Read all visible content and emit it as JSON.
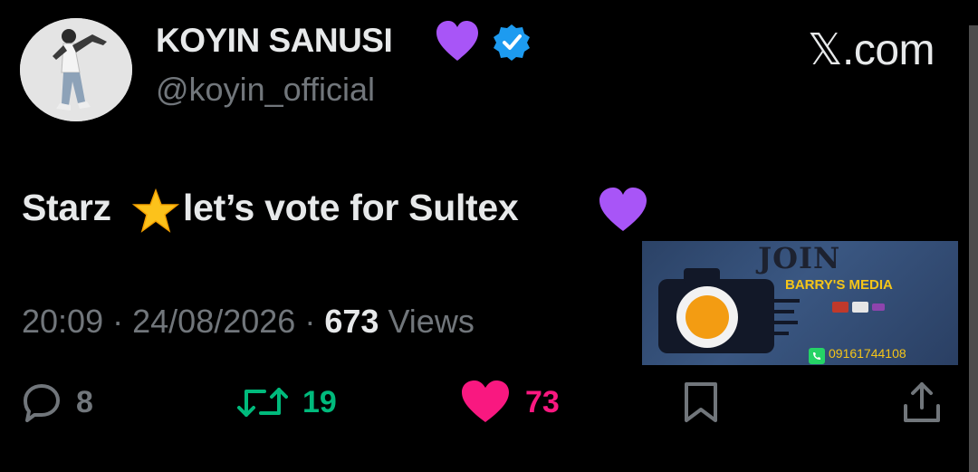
{
  "author": {
    "display_name": "KOYIN SANUSI",
    "handle": "@koyin_official",
    "name_emoji": "purple-heart-icon",
    "verified": true
  },
  "brand": "𝕏.com",
  "tweet": {
    "text_before_emoji": "Starz",
    "emoji": "star-icon",
    "text_after_emoji": "let’s vote for Sultex",
    "trailing_emoji": "purple-heart-icon"
  },
  "meta": {
    "time": "20:09",
    "separator": "·",
    "date": "24/08/2026",
    "views_count": "673",
    "views_label": "Views"
  },
  "actions": {
    "replies": "8",
    "retweets": "19",
    "likes": "73"
  },
  "ad": {
    "headline": "JOIN",
    "brand": "BARRY'S MEDIA",
    "phone": "09161744108"
  },
  "colors": {
    "background": "#000000",
    "text": "#e7e9ea",
    "muted": "#71767b",
    "verified": "#1d9bf0",
    "retweet": "#00ba7c",
    "like": "#f91880",
    "heart": "#a855f7",
    "ad_accent": "#f5c518"
  }
}
